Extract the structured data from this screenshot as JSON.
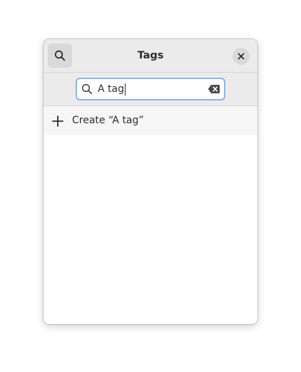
{
  "header": {
    "title": "Tags",
    "search_toggle_icon": "search-icon",
    "close_icon": "close-icon"
  },
  "search": {
    "value": "A tag",
    "search_icon": "search-icon",
    "clear_icon": "clear-text-icon",
    "focus_color": "#8cb4e6"
  },
  "list": {
    "items": [
      {
        "icon": "plus-icon",
        "label": "Create “A tag”"
      }
    ]
  }
}
